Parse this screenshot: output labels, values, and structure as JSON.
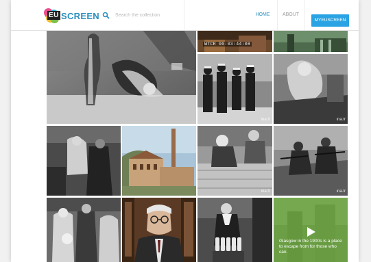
{
  "header": {
    "logo": {
      "badge": "EU",
      "text": "SCREEN"
    },
    "search": {
      "placeholder": "Search the collection"
    },
    "nav": {
      "home": "HOME",
      "about": "ABOUT",
      "my": "MYEUSCREEN"
    }
  },
  "colors": {
    "accent": "#2a8fbd",
    "button": "#29a3e3",
    "overlay_green": "#70b040"
  },
  "tiles": {
    "timecode": "WTCR 00:03:44:08",
    "watermark": "ina.fr",
    "featured_caption": "Glasgow in the 1900s is a place to escape from for those who can.",
    "items": [
      {
        "name": "bottle-hands",
        "watermark": ""
      },
      {
        "name": "newsreel-top",
        "watermark": ""
      },
      {
        "name": "street-top",
        "watermark": ""
      },
      {
        "name": "sailors",
        "watermark": "ina.fr"
      },
      {
        "name": "parade-float",
        "watermark": "ina.fr"
      },
      {
        "name": "dance-crowd",
        "watermark": ""
      },
      {
        "name": "factory-chimney",
        "watermark": ""
      },
      {
        "name": "workers-wall",
        "watermark": "ina.fr"
      },
      {
        "name": "soldiers-guns",
        "watermark": "ina.fr"
      },
      {
        "name": "nurse-group",
        "watermark": ""
      },
      {
        "name": "man-glasses",
        "watermark": ""
      },
      {
        "name": "milk-bottles",
        "watermark": ""
      },
      {
        "name": "glasgow-featured",
        "watermark": ""
      }
    ]
  }
}
